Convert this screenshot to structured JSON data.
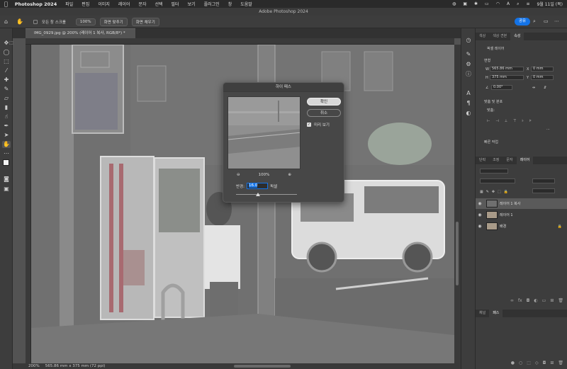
{
  "menubar": {
    "app_name": "Photoshop 2024",
    "items": [
      "파일",
      "편집",
      "이미지",
      "레이어",
      "문자",
      "선택",
      "필터",
      "보기",
      "플러그인",
      "창",
      "도움말"
    ],
    "date": "9월 11일 (목)"
  },
  "window": {
    "title": "Adobe Photoshop 2024"
  },
  "options_bar": {
    "scroll_all_label": "모든 창 스크롤",
    "zoom_label": "100%",
    "fit_screen_label": "화면 맞추기",
    "fill_screen_label": "화면 채우기",
    "share_label": "공유"
  },
  "document": {
    "tab_label": "IMG_0929.jpg @ 200% (레이어 1 복사, RGB/8*) *",
    "zoom_status": "200%",
    "size_status": "565.86 mm x 375 mm (72 ppi)"
  },
  "dialog": {
    "title": "하이 패스",
    "ok_label": "확인",
    "cancel_label": "취소",
    "preview_label": "미리 보기",
    "preview_checked": true,
    "zoom_value": "100%",
    "radius_label": "반경:",
    "radius_value": "16.0",
    "radius_unit": "픽셀"
  },
  "properties_panel": {
    "tabs": [
      "색상",
      "색상 견본",
      "속성"
    ],
    "active_tab": "속성",
    "layer_type": "픽셀 레이어",
    "transform_label": "변형",
    "w_label": "W",
    "w_value": "565.86 mm",
    "x_label": "X",
    "x_value": "0 mm",
    "h_label": "H",
    "h_value": "375 mm",
    "y_label": "Y",
    "y_value": "0 mm",
    "angle_value": "0.00°",
    "align_label": "맞춤 및 분포",
    "align_sub": "맞춤:",
    "quick_actions_label": "빠른 작업"
  },
  "layers_panel": {
    "tabs": [
      "단락",
      "조정",
      "문자",
      "레이어"
    ],
    "active_tab": "레이어",
    "layers": [
      {
        "name": "레이어 1 복사",
        "selected": true,
        "locked": false
      },
      {
        "name": "레이어 1",
        "selected": false,
        "locked": false
      },
      {
        "name": "배경",
        "selected": false,
        "locked": true
      }
    ]
  },
  "channels_panel": {
    "tabs": [
      "채널",
      "패스"
    ],
    "active_tab": "패스"
  },
  "colors": {
    "accent": "#1473e6",
    "panel_bg": "#3d3d3d",
    "canvas_bg": "#535353"
  }
}
